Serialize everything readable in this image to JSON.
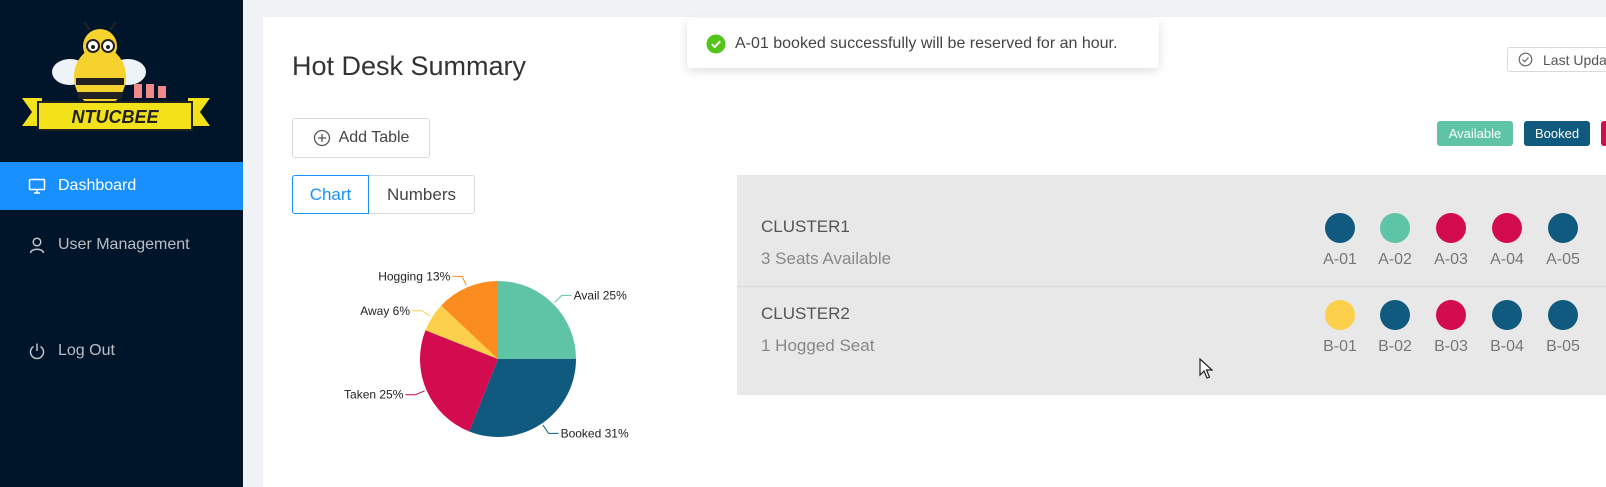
{
  "sidebar": {
    "logo_text": "NTUCBEE",
    "items": [
      {
        "label": "Dashboard",
        "icon": "desktop-icon",
        "active": true
      },
      {
        "label": "User Management",
        "icon": "user-icon",
        "active": false
      },
      {
        "label": "Log Out",
        "icon": "power-icon",
        "active": false
      }
    ]
  },
  "main": {
    "title": "Hot Desk Summary",
    "add_table_label": "Add Table",
    "tabs": [
      {
        "label": "Chart",
        "selected": true
      },
      {
        "label": "Numbers",
        "selected": false
      }
    ],
    "last_updated_label": "Last Upda",
    "legend": [
      {
        "label": "Available",
        "color": "#5fc4a6"
      },
      {
        "label": "Booked",
        "color": "#0f5a7e"
      },
      {
        "label": "",
        "color": "#d20c4f"
      }
    ],
    "clusters": [
      {
        "name": "CLUSTER1",
        "status": "3 Seats Available",
        "seats": [
          {
            "id": "A-01",
            "color": "#0f5a7e"
          },
          {
            "id": "A-02",
            "color": "#5fc4a6"
          },
          {
            "id": "A-03",
            "color": "#d20c4f"
          },
          {
            "id": "A-04",
            "color": "#d20c4f"
          },
          {
            "id": "A-05",
            "color": "#0f5a7e"
          }
        ]
      },
      {
        "name": "CLUSTER2",
        "status": "1 Hogged Seat",
        "seats": [
          {
            "id": "B-01",
            "color": "#fcd04b"
          },
          {
            "id": "B-02",
            "color": "#0f5a7e"
          },
          {
            "id": "B-03",
            "color": "#d20c4f"
          },
          {
            "id": "B-04",
            "color": "#0f5a7e"
          },
          {
            "id": "B-05",
            "color": "#0f5a7e"
          }
        ]
      }
    ]
  },
  "toast": {
    "message": "A-01 booked successfully will be reserved for an hour."
  },
  "chart_data": {
    "type": "pie",
    "slices": [
      {
        "label": "Avail",
        "value": 25,
        "color": "#5fc4a6"
      },
      {
        "label": "Booked",
        "value": 31,
        "color": "#0f5a7e"
      },
      {
        "label": "Taken",
        "value": 25,
        "color": "#d20c4f"
      },
      {
        "label": "Away",
        "value": 6,
        "color": "#fcd04b"
      },
      {
        "label": "Hogging",
        "value": 13,
        "color": "#fb8c1f"
      }
    ]
  }
}
